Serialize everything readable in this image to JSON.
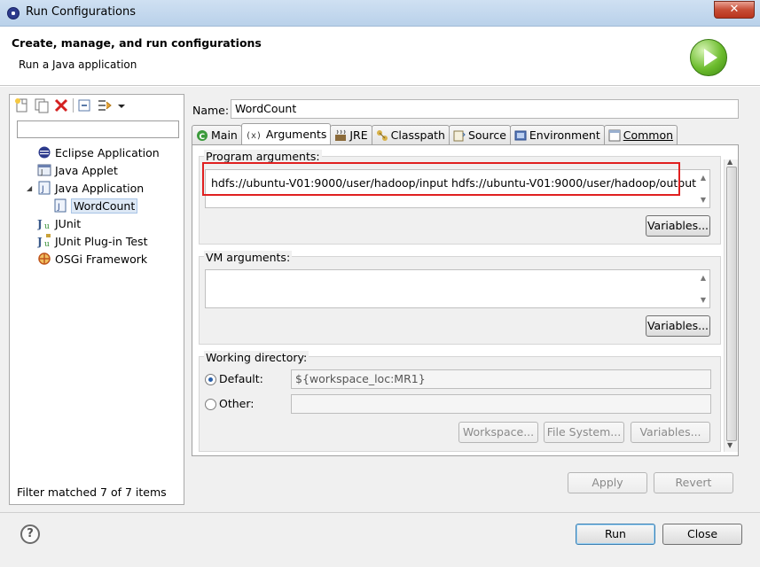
{
  "window": {
    "title": "Run Configurations",
    "close_glyph": "✕"
  },
  "header": {
    "title": "Create, manage, and run configurations",
    "subtitle": "Run a Java application"
  },
  "left": {
    "filter_placeholder": "",
    "tree": [
      {
        "label": "Eclipse Application",
        "icon": "eclipse-icon"
      },
      {
        "label": "Java Applet",
        "icon": "java-applet-icon"
      },
      {
        "label": "Java Application",
        "icon": "java-application-icon",
        "expanded": true
      },
      {
        "label": "WordCount",
        "icon": "java-config-icon",
        "selected": true
      },
      {
        "label": "JUnit",
        "icon": "junit-icon"
      },
      {
        "label": "JUnit Plug-in Test",
        "icon": "junit-plugin-icon"
      },
      {
        "label": "OSGi Framework",
        "icon": "osgi-icon"
      }
    ],
    "filter_status": "Filter matched 7 of 7 items"
  },
  "config": {
    "name_label": "Name:",
    "name_value": "WordCount",
    "tabs": [
      {
        "label": "Main",
        "icon": "main-tab-icon"
      },
      {
        "label": "Arguments",
        "icon": "arguments-tab-icon",
        "active": true
      },
      {
        "label": "JRE",
        "icon": "jre-tab-icon"
      },
      {
        "label": "Classpath",
        "icon": "classpath-tab-icon"
      },
      {
        "label": "Source",
        "icon": "source-tab-icon"
      },
      {
        "label": "Environment",
        "icon": "environment-tab-icon"
      },
      {
        "label": "Common",
        "icon": "common-tab-icon"
      }
    ],
    "program_args_label": "Program arguments:",
    "program_args_value": "hdfs://ubuntu-V01:9000/user/hadoop/input hdfs://ubuntu-V01:9000/user/hadoop/output",
    "vm_args_label": "VM arguments:",
    "vm_args_value": "",
    "variables_label": "Variables...",
    "working_dir_label": "Working directory:",
    "default_label": "Default:",
    "default_value": "${workspace_loc:MR1}",
    "other_label": "Other:",
    "other_value": "",
    "workspace_btn": "Workspace...",
    "filesystem_btn": "File System...",
    "variables_btn": "Variables...",
    "highlight_color": "#e02020"
  },
  "actions": {
    "apply": "Apply",
    "revert": "Revert",
    "run": "Run",
    "close": "Close",
    "help": "?"
  }
}
